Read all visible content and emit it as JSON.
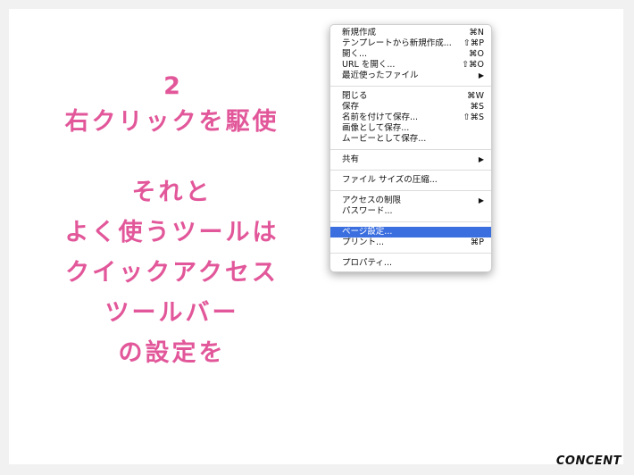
{
  "slide": {
    "step_number": "2",
    "heading": "右クリックを駆使",
    "lines": [
      "それと",
      "よく使うツールは",
      "クイックアクセス",
      "ツールバー",
      "の設定を"
    ]
  },
  "menu": {
    "items": {
      "new": {
        "label": "新規作成",
        "shortcut": "⌘N"
      },
      "from_template": {
        "label": "テンプレートから新規作成...",
        "shortcut": "⇧⌘P"
      },
      "open": {
        "label": "開く...",
        "shortcut": "⌘O"
      },
      "open_url": {
        "label": "URL を開く...",
        "shortcut": "⇧⌘O"
      },
      "recent": {
        "label": "最近使ったファイル",
        "arrow": "▶"
      },
      "close": {
        "label": "閉じる",
        "shortcut": "⌘W"
      },
      "save": {
        "label": "保存",
        "shortcut": "⌘S"
      },
      "save_as": {
        "label": "名前を付けて保存...",
        "shortcut": "⇧⌘S"
      },
      "save_image": {
        "label": "画像として保存..."
      },
      "save_movie": {
        "label": "ムービーとして保存..."
      },
      "share": {
        "label": "共有",
        "arrow": "▶"
      },
      "compress": {
        "label": "ファイル サイズの圧縮..."
      },
      "restrict": {
        "label": "アクセスの制限",
        "arrow": "▶"
      },
      "password": {
        "label": "パスワード..."
      },
      "page_setup": {
        "label": "ページ設定..."
      },
      "print": {
        "label": "プリント...",
        "shortcut": "⌘P"
      },
      "properties": {
        "label": "プロパティ..."
      }
    }
  },
  "brand": "CONCENT",
  "colors": {
    "accent_pink": "#e2579a",
    "menu_highlight": "#3b6fe0"
  }
}
